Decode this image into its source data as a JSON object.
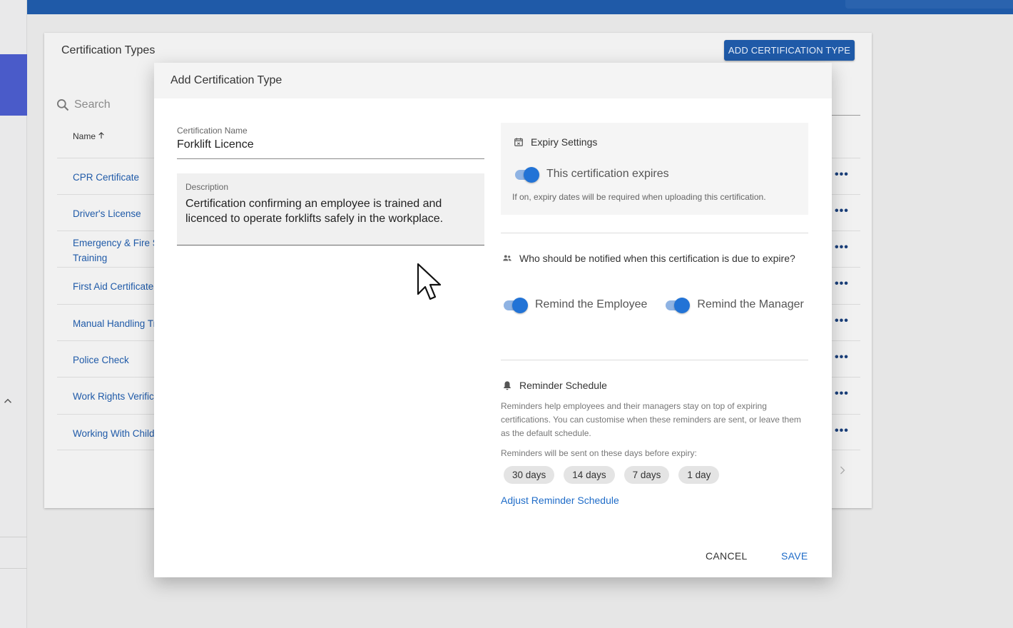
{
  "background": {
    "card_title": "Certification Types",
    "add_button": "ADD CERTIFICATION TYPE",
    "search_placeholder": "Search",
    "column_name": "Name",
    "sort_icon": "arrow-up-icon",
    "rows": [
      {
        "label": "CPR Certificate"
      },
      {
        "label": "Driver's License"
      },
      {
        "label": "Emergency & Fire S\nTraining"
      },
      {
        "label": "First Aid Certificate"
      },
      {
        "label": "Manual Handling Tr"
      },
      {
        "label": "Police Check"
      },
      {
        "label": "Work Rights Verifica"
      },
      {
        "label": "Working With Childr"
      }
    ],
    "row_more": "•••",
    "accent_color": "#1f5aa8"
  },
  "modal": {
    "title": "Add Certification Type",
    "name_field": {
      "label": "Certification Name",
      "value": "Forklift Licence"
    },
    "description_field": {
      "label": "Description",
      "value": "Certification confirming an employee is trained and licenced to operate forklifts safely in the workplace."
    },
    "expiry": {
      "title": "Expiry Settings",
      "toggle_label": "This certification expires",
      "toggle_on": true,
      "hint": "If on, expiry dates will be required when uploading this certification."
    },
    "notify": {
      "question": "Who should be notified when this certification is due to expire?",
      "employee_label": "Remind the Employee",
      "employee_on": true,
      "manager_label": "Remind the Manager",
      "manager_on": true
    },
    "reminder": {
      "title": "Reminder Schedule",
      "description": "Reminders help employees and their managers stay on top of expiring certifications. You can customise when these reminders are sent, or leave them as the default schedule.",
      "days_label": "Reminders will be sent on these days before expiry:",
      "chips": [
        "30 days",
        "14 days",
        "7 days",
        "1 day"
      ],
      "adjust_link": "Adjust Reminder Schedule"
    },
    "cancel_label": "CANCEL",
    "save_label": "SAVE",
    "primary_color": "#2273d6"
  }
}
